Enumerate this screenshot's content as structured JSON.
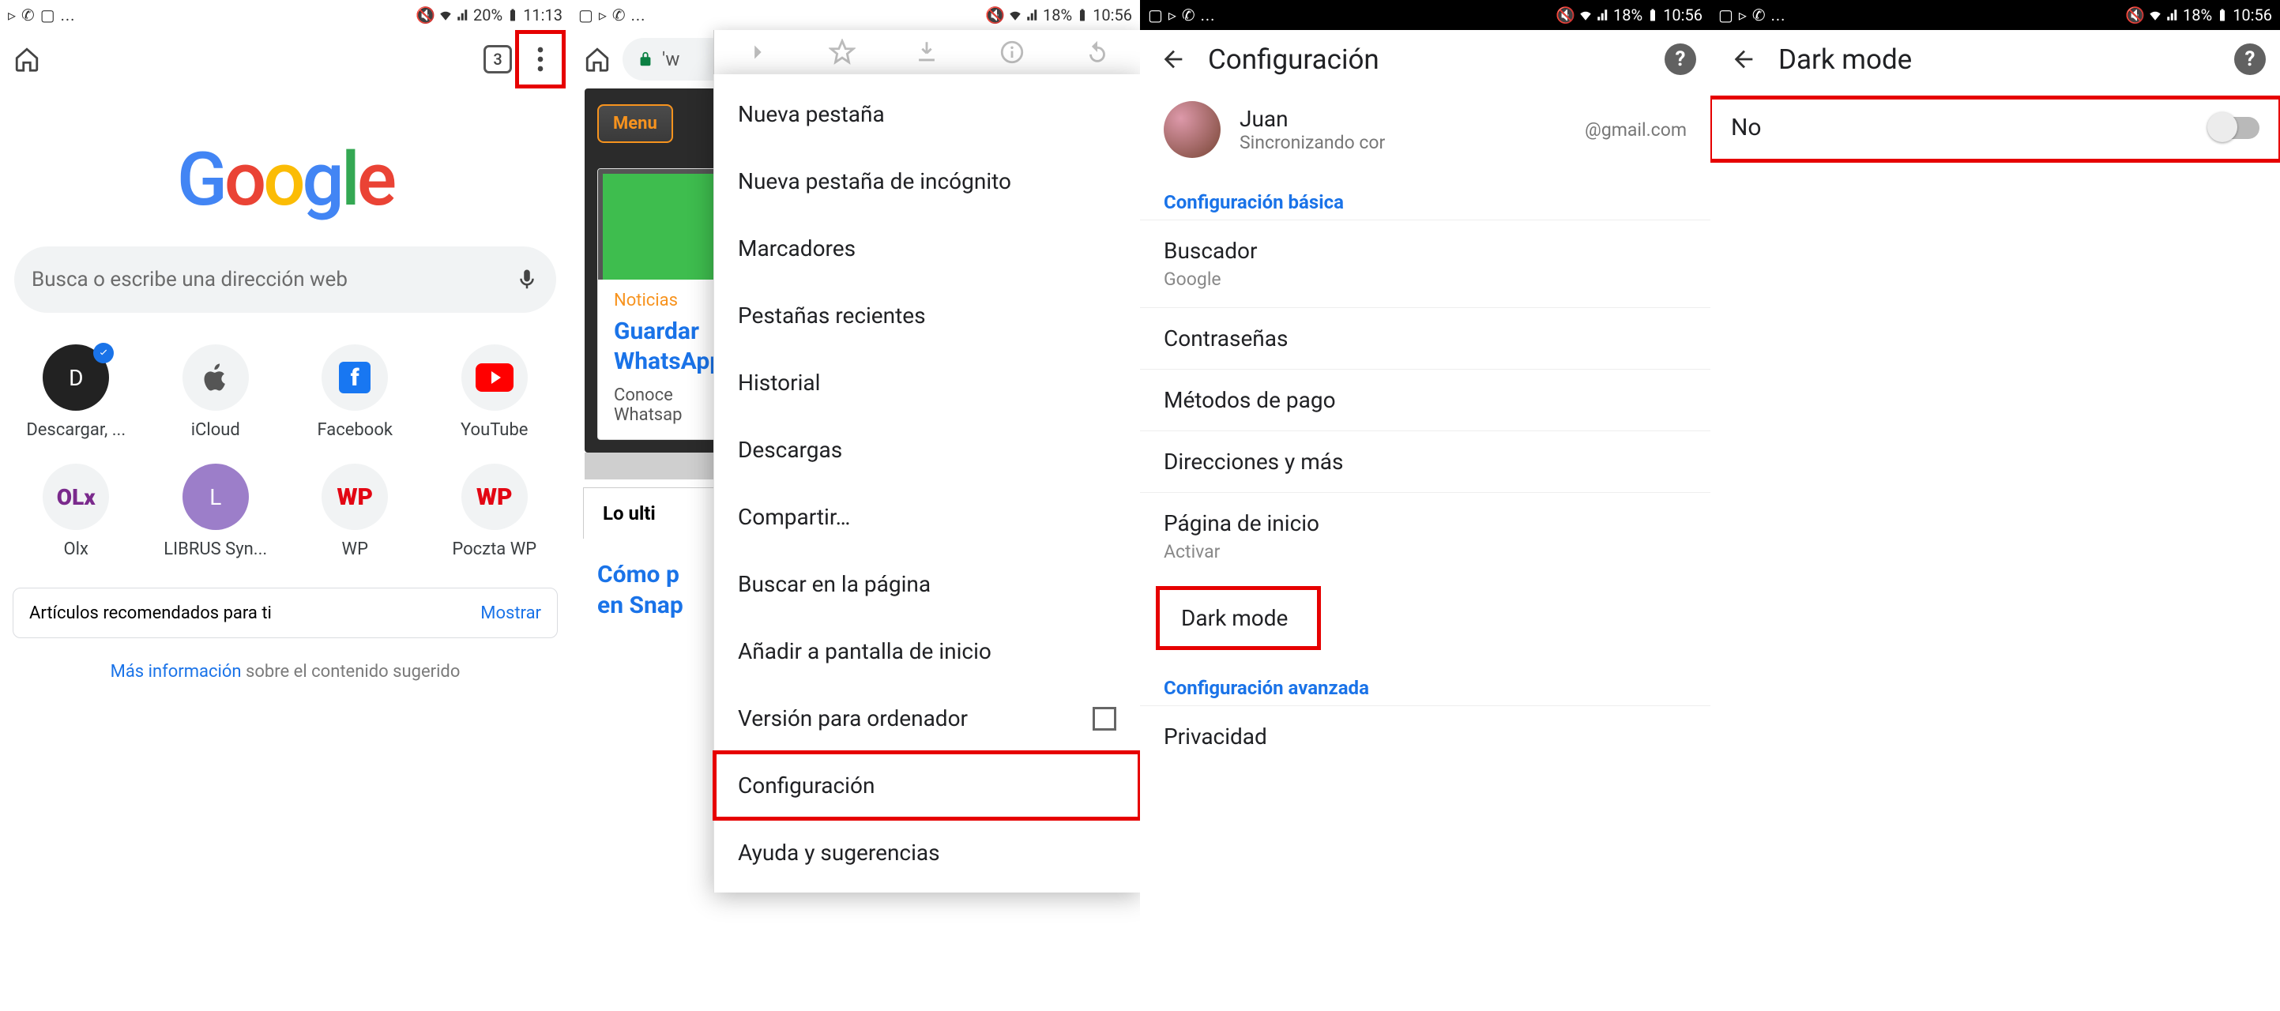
{
  "s1": {
    "status": {
      "left": "▹ ✆ ▢ ...",
      "battery": "20%",
      "time": "11:13"
    },
    "tabCount": "3",
    "searchPlaceholder": "Busca o escribe una dirección web",
    "tiles": [
      {
        "label": "Descargar, ...",
        "letter": "D",
        "dark": true,
        "check": true
      },
      {
        "label": "iCloud"
      },
      {
        "label": "Facebook"
      },
      {
        "label": "YouTube"
      },
      {
        "label": "Olx"
      },
      {
        "label": "LIBRUS Syn...",
        "letter": "L"
      },
      {
        "label": "WP"
      },
      {
        "label": "Poczta WP"
      }
    ],
    "recommend": {
      "label": "Artículos recomendados para ti",
      "action": "Mostrar"
    },
    "suggest": {
      "link": "Más información",
      "rest": " sobre el contenido sugerido"
    }
  },
  "s2": {
    "status": {
      "left": "▢ ▹ ✆ ...",
      "battery": "18%",
      "time": "10:56"
    },
    "urlStub": "'w",
    "menuBtn": "Menu",
    "article1": {
      "tag": "Noticias",
      "title": "Guardar\nWhatsApp",
      "desc": "Conoce\nWhatsap"
    },
    "tab": "Lo ulti",
    "article2": "Cómo p\nen Snap",
    "menu": [
      "Nueva pestaña",
      "Nueva pestaña de incógnito",
      "Marcadores",
      "Pestañas recientes",
      "Historial",
      "Descargas",
      "Compartir…",
      "Buscar en la página",
      "Añadir a pantalla de inicio",
      "Versión para ordenador",
      "Configuración",
      "Ayuda y sugerencias"
    ]
  },
  "s3": {
    "status": {
      "left": "▢ ▹ ✆ ...",
      "battery": "18%",
      "time": "10:56"
    },
    "title": "Configuración",
    "account": {
      "name": "Juan",
      "status": "Sincronizando cor",
      "email": "@gmail.com"
    },
    "basic": "Configuración básica",
    "rows": [
      {
        "t": "Buscador",
        "s": "Google"
      },
      {
        "t": "Contraseñas"
      },
      {
        "t": "Métodos de pago"
      },
      {
        "t": "Direcciones y más"
      },
      {
        "t": "Página de inicio",
        "s": "Activar"
      },
      {
        "t": "Dark mode",
        "hl": true
      }
    ],
    "advanced": "Configuración avanzada",
    "priv": "Privacidad"
  },
  "s4": {
    "status": {
      "left": "▢ ▹ ✆ ...",
      "battery": "18%",
      "time": "10:56"
    },
    "title": "Dark mode",
    "toggleLabel": "No"
  }
}
